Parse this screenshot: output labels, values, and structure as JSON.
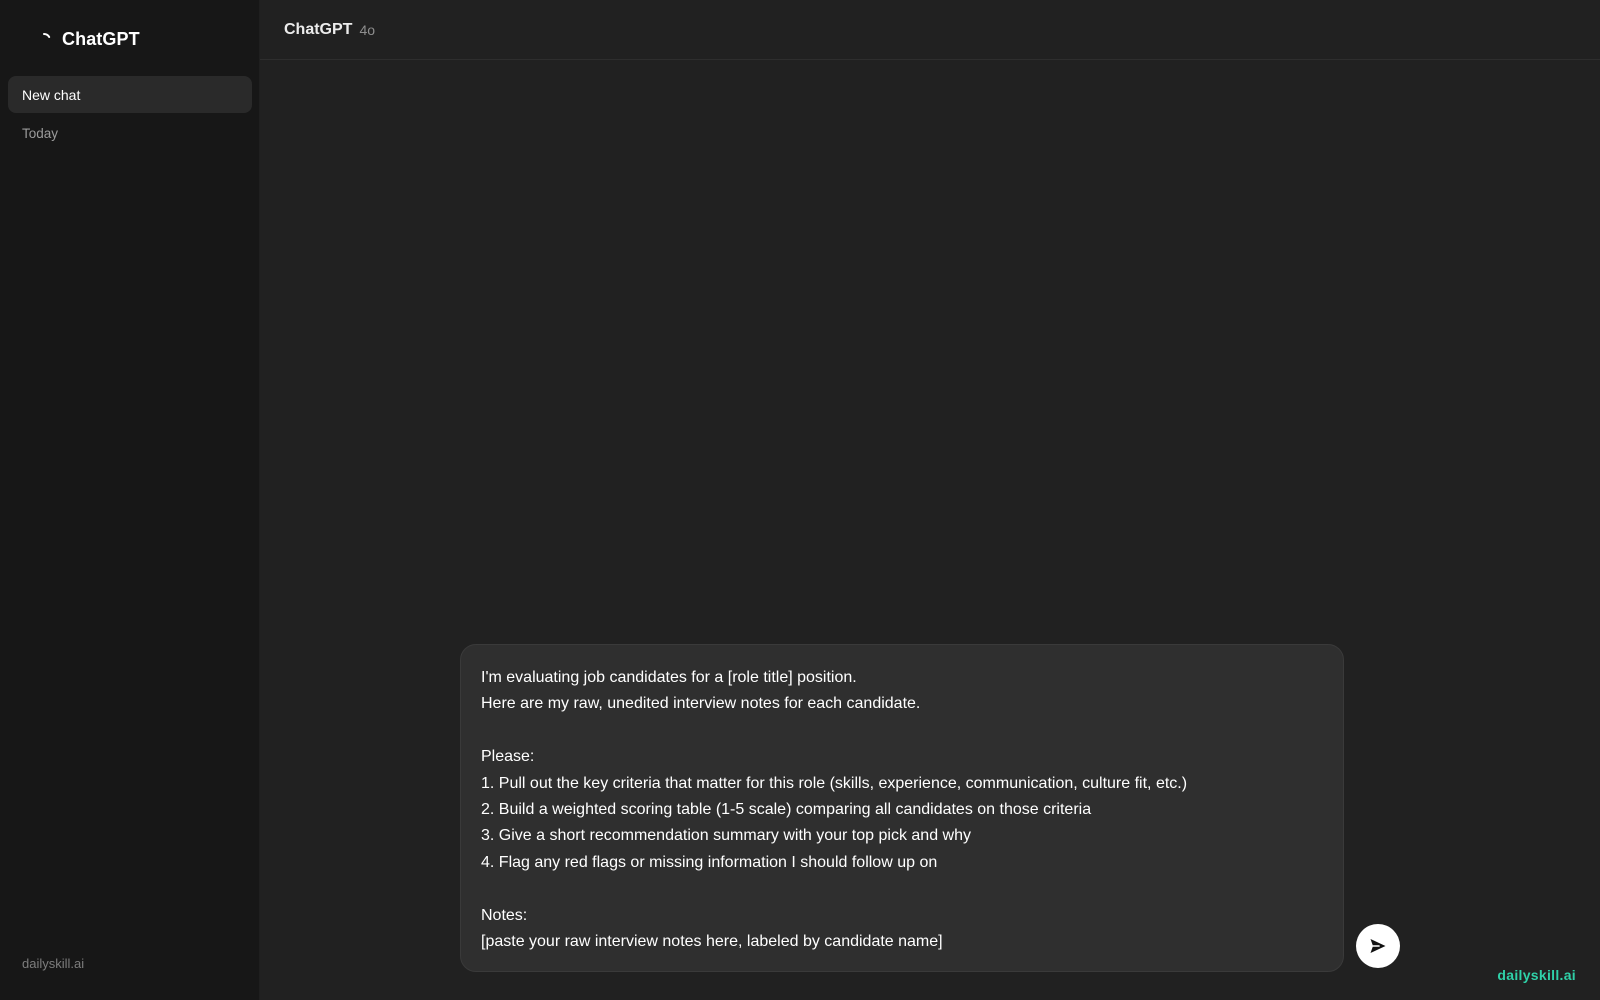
{
  "sidebar": {
    "brand": "ChatGPT",
    "brand_icon": "loading-spinner-icon",
    "new_chat_label": "New chat",
    "section_label": "Today",
    "footer": "dailyskill.ai"
  },
  "header": {
    "model_name": "ChatGPT",
    "model_version": "4o"
  },
  "composer": {
    "text": "I'm evaluating job candidates for a [role title] position.\nHere are my raw, unedited interview notes for each candidate.\n\nPlease:\n1. Pull out the key criteria that matter for this role (skills, experience, communication, culture fit, etc.)\n2. Build a weighted scoring table (1-5 scale) comparing all candidates on those criteria\n3. Give a short recommendation summary with your top pick and why\n4. Flag any red flags or missing information I should follow up on\n\nNotes:\n[paste your raw interview notes here, labeled by candidate name]",
    "send_icon": "send-arrow-icon"
  },
  "watermark": "dailyskill.ai",
  "colors": {
    "sidebar_bg": "#171717",
    "main_bg": "#212121",
    "composer_bg": "#2f2f2f",
    "accent": "#2fd1a8"
  }
}
